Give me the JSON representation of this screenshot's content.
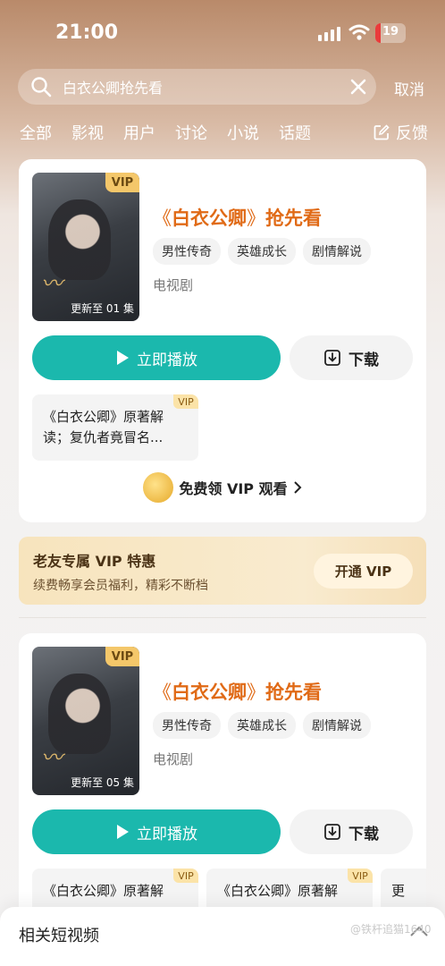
{
  "status": {
    "time": "21:00",
    "battery_level": "19"
  },
  "search": {
    "query": "白衣公卿抢先看",
    "cancel_label": "取消"
  },
  "tabs": [
    "全部",
    "影视",
    "用户",
    "讨论",
    "小说",
    "话题"
  ],
  "feedback_label": "反馈",
  "cards": [
    {
      "poster_vip": "VIP",
      "poster_episode": "更新至 01 集",
      "title_open": "《",
      "title_name": "白衣公卿",
      "title_close": "》",
      "title_suffix": "抢先看",
      "tags": [
        "男性传奇",
        "英雄成长",
        "剧情解说"
      ],
      "genre": "电视剧",
      "play_label": "立即播放",
      "download_label": "下载",
      "docs": [
        {
          "text": "《白衣公卿》原著解读；复仇者竟冒名...",
          "vip": "VIP"
        }
      ],
      "free_vip_label": "免费领 VIP 观看"
    },
    {
      "poster_vip": "VIP",
      "poster_episode": "更新至 05 集",
      "title_open": "《",
      "title_name": "白衣公卿",
      "title_close": "》",
      "title_suffix": "抢先看",
      "tags": [
        "男性传奇",
        "英雄成长",
        "剧情解说"
      ],
      "genre": "电视剧",
      "play_label": "立即播放",
      "download_label": "下载",
      "docs": [
        {
          "text": "《白衣公卿》原著解",
          "vip": "VIP"
        },
        {
          "text": "《白衣公卿》原著解",
          "vip": "VIP"
        },
        {
          "text": "更",
          "vip": ""
        }
      ]
    }
  ],
  "promo": {
    "heading": "老友专属 VIP 特惠",
    "subtitle": "续费畅享会员福利，精彩不断档",
    "button_label": "开通 VIP"
  },
  "bottom_sheet": {
    "title": "相关短视频"
  },
  "watermark": "@铁杆追猫1640"
}
